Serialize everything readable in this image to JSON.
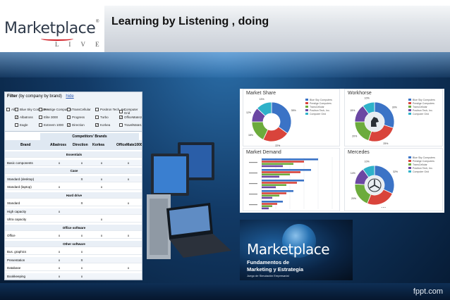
{
  "header": {
    "logo_text": "Marketplace",
    "logo_reg": "®",
    "logo_sub": "L I V E",
    "title": "Learning by Listening , doing"
  },
  "footer": {
    "brand": "fppt.com"
  },
  "filter": {
    "title": "Filter",
    "subtitle": "(by company by brand)",
    "hide": "hide",
    "all": "All",
    "options": [
      {
        "label": "Blue Sky Computers",
        "checked": false
      },
      {
        "label": "Prestige Computers",
        "checked": false
      },
      {
        "label": "TransCellular",
        "checked": false
      },
      {
        "label": "Positron Tech, Inc.",
        "checked": false
      },
      {
        "label": "Computer Grid",
        "checked": false
      },
      {
        "label": "Albatross",
        "checked": true
      },
      {
        "label": "Elite 3000",
        "checked": false
      },
      {
        "label": "Progress",
        "checked": false
      },
      {
        "label": "Turbo",
        "checked": false
      },
      {
        "label": "OfficeMate1000",
        "checked": true
      },
      {
        "label": "Eagle",
        "checked": false
      },
      {
        "label": "Extreem 1000",
        "checked": false
      },
      {
        "label": "Direction",
        "checked": true
      },
      {
        "label": "Korkea",
        "checked": true
      },
      {
        "label": "TravelMate1000",
        "checked": false
      }
    ]
  },
  "brands_table": {
    "group_header": "Competitors' Brands",
    "columns": [
      "Brand",
      "Albatross",
      "Direction",
      "Korkea",
      "OfficeMate1000"
    ],
    "rows": [
      {
        "type": "sec",
        "label": "Essentials"
      },
      {
        "type": "row",
        "label": "Basic components",
        "cells": [
          "x",
          "x",
          "x",
          "x"
        ]
      },
      {
        "type": "sec",
        "label": "Case"
      },
      {
        "type": "row",
        "label": "Standard (desktop)",
        "cells": [
          "",
          "X",
          "x",
          "x"
        ]
      },
      {
        "type": "row",
        "label": "Standard (laptop)",
        "cells": [
          "x",
          "",
          "x",
          ""
        ]
      },
      {
        "type": "sec",
        "label": "Hard drive"
      },
      {
        "type": "row",
        "label": "Standard",
        "cells": [
          "",
          "X",
          "",
          "x"
        ]
      },
      {
        "type": "row",
        "label": "High capacity",
        "cells": [
          "x",
          "",
          "",
          ""
        ]
      },
      {
        "type": "row",
        "label": "Ultra capacity",
        "cells": [
          "",
          "",
          "x",
          ""
        ]
      },
      {
        "type": "sec",
        "label": "Office software"
      },
      {
        "type": "row",
        "label": "Office",
        "cells": [
          "x",
          "x",
          "x",
          "x"
        ]
      },
      {
        "type": "sec",
        "label": "Other software"
      },
      {
        "type": "row",
        "label": "Bus. graphics",
        "cells": [
          "x",
          "x",
          "",
          ""
        ]
      },
      {
        "type": "row",
        "label": "Presentation",
        "cells": [
          "x",
          "X",
          "",
          ""
        ]
      },
      {
        "type": "row",
        "label": "Database",
        "cells": [
          "x",
          "x",
          "",
          "x"
        ]
      },
      {
        "type": "row",
        "label": "Bookkeeping",
        "cells": [
          "x",
          "x",
          "",
          ""
        ]
      }
    ]
  },
  "charts": {
    "market_share": {
      "title": "Market Share",
      "legend": [
        "Blue Sky Computers",
        "Prestige Computers",
        "TransCellular",
        "Positron Tech, Inc.",
        "Computer Grid"
      ],
      "colors": [
        "#3b73c6",
        "#d9443b",
        "#6cab3c",
        "#6b47a3",
        "#2fb2c9"
      ],
      "values": [
        35,
        22,
        18,
        12,
        13
      ],
      "labels": [
        "35%",
        "22%",
        "18%",
        "12%",
        "13%"
      ]
    },
    "workhorse": {
      "title": "Workhorse",
      "legend": [
        "Blue Sky Computers",
        "Prestige Computers",
        "TransCellular",
        "Positron Tech, Inc.",
        "Computer Grid"
      ],
      "colors": [
        "#3b73c6",
        "#d9443b",
        "#6cab3c",
        "#6b47a3",
        "#2fb2c9"
      ],
      "values": [
        30,
        25,
        20,
        15,
        10
      ],
      "labels": [
        "30%",
        "25%",
        "20%",
        "15%",
        "10%"
      ]
    },
    "market_demand": {
      "title": "Market Demand",
      "categories": [
        "",
        "",
        "",
        "",
        ""
      ],
      "series_colors": [
        "#3b73c6",
        "#d9443b",
        "#6cab3c",
        "#6b47a3"
      ],
      "bars": [
        [
          80,
          60,
          45,
          30
        ],
        [
          70,
          55,
          40,
          25
        ],
        [
          60,
          50,
          35,
          20
        ],
        [
          45,
          35,
          25,
          15
        ],
        [
          30,
          22,
          15,
          10
        ]
      ]
    },
    "mercedes": {
      "title": "Mercedes",
      "legend": [
        "Blue Sky Computers",
        "Prestige Computers",
        "TransCellular",
        "Positron Tech, Inc.",
        "Computer Grid"
      ],
      "colors": [
        "#3b73c6",
        "#d9443b",
        "#6cab3c",
        "#6b47a3",
        "#2fb2c9"
      ],
      "values": [
        32,
        24,
        20,
        14,
        10
      ],
      "labels": [
        "32%",
        "24%",
        "20%",
        "14%",
        "10%"
      ]
    }
  },
  "promo": {
    "brand": "Marketplace",
    "line1": "Fundamentos de",
    "line2": "Marketing y Estrategia",
    "line3": "Juego de Simulación Empresarial"
  }
}
